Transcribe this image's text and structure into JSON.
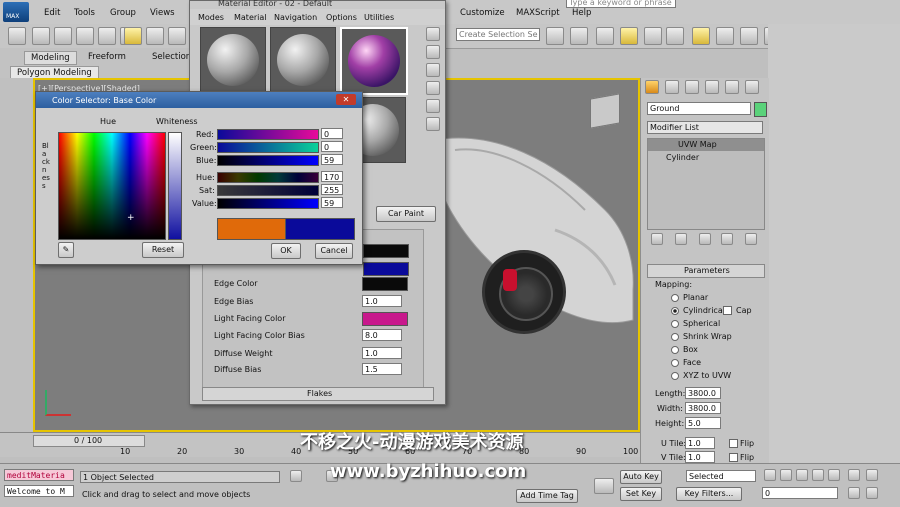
{
  "menubar": {
    "app_label": "MAX",
    "items": [
      "Edit",
      "Tools",
      "Group",
      "Views",
      "Customize",
      "MAXScript",
      "Help"
    ],
    "search_placeholder": "Type a keyword or phrase"
  },
  "toolbar": {
    "selection_set_placeholder": "Create Selection Se"
  },
  "ribbon": {
    "tabs": [
      "Modeling",
      "Freeform",
      "Selection"
    ],
    "subtab": "Polygon Modeling"
  },
  "viewport": {
    "label": "[+][Perspective][Shaded]"
  },
  "material_editor": {
    "title": "Material Editor - 02 - Default",
    "menu": [
      "Modes",
      "Material",
      "Navigation",
      "Options",
      "Utilities"
    ],
    "material_type": "Car Paint",
    "params": [
      {
        "label": "Edge Color",
        "kind": "swatch",
        "color": "#0a0a0a"
      },
      {
        "label": "Edge Bias",
        "kind": "value",
        "value": "1.0"
      },
      {
        "label": "Light Facing Color",
        "kind": "swatch",
        "color": "#c8188c"
      },
      {
        "label": "Light Facing Color Bias",
        "kind": "value",
        "value": "8.0"
      },
      {
        "label": "Diffuse Weight",
        "kind": "value",
        "value": "1.0"
      },
      {
        "label": "Diffuse Bias",
        "kind": "value",
        "value": "1.5"
      }
    ],
    "flakes_label": "Flakes"
  },
  "color_selector": {
    "title": "Color Selector: Base Color",
    "hue_label": "Hue",
    "whiteness_label": "Whiteness",
    "blackness_label": "Blackness",
    "channels": [
      {
        "label": "Red:",
        "value": "0"
      },
      {
        "label": "Green:",
        "value": "0"
      },
      {
        "label": "Blue:",
        "value": "59"
      },
      {
        "label": "Hue:",
        "value": "170"
      },
      {
        "label": "Sat:",
        "value": "255"
      },
      {
        "label": "Value:",
        "value": "59"
      }
    ],
    "reset_label": "Reset",
    "ok_label": "OK",
    "cancel_label": "Cancel",
    "old_color": "#e06a0a",
    "new_color": "#0a0a9a"
  },
  "command_panel": {
    "object_name": "Ground",
    "object_color": "#5ad27a",
    "modifier_list_label": "Modifier List",
    "stack": [
      "UVW Map",
      "Cylinder"
    ],
    "parameters_title": "Parameters",
    "mapping_label": "Mapping:",
    "mapping_options": [
      "Planar",
      "Cylindrical",
      "Spherical",
      "Shrink Wrap",
      "Box",
      "Face",
      "XYZ to UVW"
    ],
    "selected_mapping": "Cylindrical",
    "cap_label": "Cap",
    "length_label": "Length:",
    "length_value": "3800.0",
    "width_label": "Width:",
    "width_value": "3800.0",
    "height_label": "Height:",
    "height_value": "5.0",
    "utile_label": "U Tile:",
    "utile_value": "1.0",
    "vtile_label": "V Tile:",
    "vtile_value": "1.0",
    "flip_label": "Flip"
  },
  "timeline": {
    "frame": "0 / 100",
    "ticks": [
      "10",
      "20",
      "30",
      "40",
      "50",
      "60",
      "70",
      "80",
      "90",
      "100"
    ]
  },
  "statusbar": {
    "script_line1": "meditMateria",
    "script_line2": "Welcome to M",
    "selection_status": "1 Object Selected",
    "prompt": "Click and drag to select and move objects",
    "add_time_tag": "Add Time Tag",
    "auto_key": "Auto Key",
    "set_key": "Set Key",
    "selected_dropdown": "Selected",
    "key_filters": "Key Filters...",
    "frame_field": "0"
  },
  "watermark": {
    "line1": "不移之火-动漫游戏美术资源",
    "line2": "www.byzhihuo.com"
  }
}
